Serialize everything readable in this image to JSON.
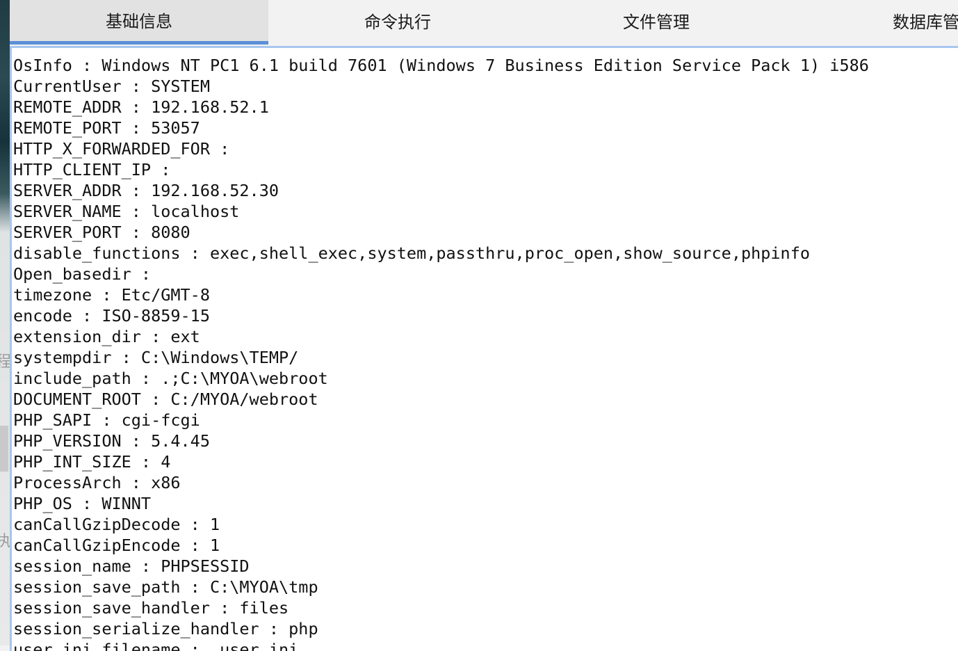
{
  "tabs": [
    {
      "label": "基础信息",
      "active": true
    },
    {
      "label": "命令执行",
      "active": false
    },
    {
      "label": "文件管理",
      "active": false
    },
    {
      "label": "数据库管",
      "active": false
    }
  ],
  "background_fragments": [
    "程",
    "执"
  ],
  "colors": {
    "tab_active_underline": "#5b8fd9",
    "content_border": "#a8c6ee"
  },
  "info_lines": [
    "OsInfo : Windows NT PC1 6.1 build 7601 (Windows 7 Business Edition Service Pack 1) i586",
    "CurrentUser : SYSTEM",
    "REMOTE_ADDR : 192.168.52.1",
    "REMOTE_PORT : 53057",
    "HTTP_X_FORWARDED_FOR :",
    "HTTP_CLIENT_IP :",
    "SERVER_ADDR : 192.168.52.30",
    "SERVER_NAME : localhost",
    "SERVER_PORT : 8080",
    "disable_functions : exec,shell_exec,system,passthru,proc_open,show_source,phpinfo",
    "Open_basedir :",
    "timezone : Etc/GMT-8",
    "encode : ISO-8859-15",
    "extension_dir : ext",
    "systempdir : C:\\Windows\\TEMP/",
    "include_path : .;C:\\MYOA\\webroot",
    "DOCUMENT_ROOT : C:/MYOA/webroot",
    "PHP_SAPI : cgi-fcgi",
    "PHP_VERSION : 5.4.45",
    "PHP_INT_SIZE : 4",
    "ProcessArch : x86",
    "PHP_OS : WINNT",
    "canCallGzipDecode : 1",
    "canCallGzipEncode : 1",
    "session_name : PHPSESSID",
    "session_save_path : C:\\MYOA\\tmp",
    "session_save_handler : files",
    "session_serialize_handler : php",
    "user_ini_filename : .user.ini"
  ]
}
